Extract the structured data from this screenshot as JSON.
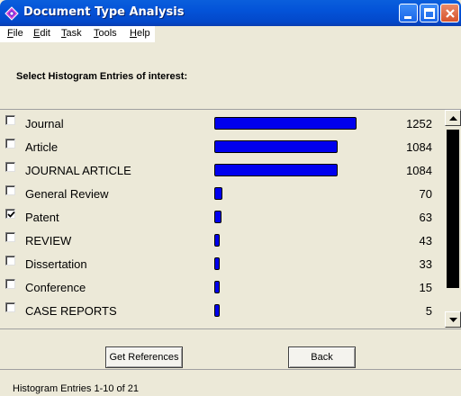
{
  "window": {
    "title": "Document Type Analysis",
    "accent": "#0453d8"
  },
  "menu": [
    {
      "key": "F",
      "rest": "ile"
    },
    {
      "key": "E",
      "rest": "dit"
    },
    {
      "key": "T",
      "rest": "ask"
    },
    {
      "key": "T",
      "rest": "ools"
    },
    {
      "key": "H",
      "rest": "elp"
    }
  ],
  "instruction": "Select Histogram Entries of interest:",
  "histogram": {
    "bar_color": "#0000ee",
    "max_value": 1252,
    "entries": [
      {
        "label": "Journal",
        "count": "1252",
        "value": 1252,
        "checked": false
      },
      {
        "label": "Article",
        "count": "1084",
        "value": 1084,
        "checked": false
      },
      {
        "label": "JOURNAL ARTICLE",
        "count": "1084",
        "value": 1084,
        "checked": false
      },
      {
        "label": "General Review",
        "count": "70",
        "value": 70,
        "checked": false
      },
      {
        "label": "Patent",
        "count": "63",
        "value": 63,
        "checked": true
      },
      {
        "label": "REVIEW",
        "count": "43",
        "value": 43,
        "checked": false
      },
      {
        "label": "Dissertation",
        "count": "33",
        "value": 33,
        "checked": false
      },
      {
        "label": "Conference",
        "count": "15",
        "value": 15,
        "checked": false
      },
      {
        "label": "CASE REPORTS",
        "count": "5",
        "value": 5,
        "checked": false
      }
    ]
  },
  "buttons": {
    "get_references": "Get References",
    "back": "Back"
  },
  "status": "Histogram Entries 1-10 of 21"
}
